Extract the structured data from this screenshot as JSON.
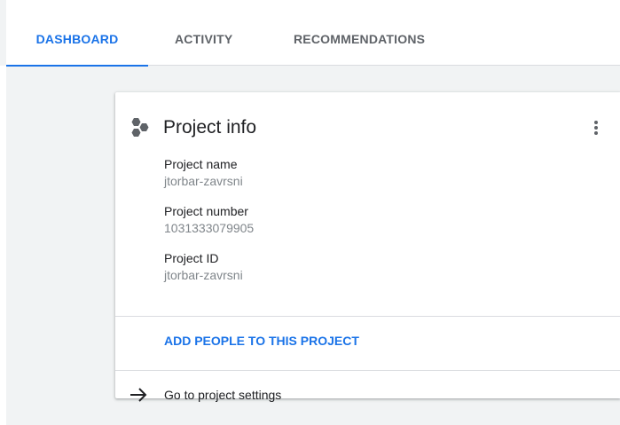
{
  "tabs": {
    "dashboard": "DASHBOARD",
    "activity": "ACTIVITY",
    "recommendations": "RECOMMENDATIONS",
    "active": "dashboard"
  },
  "card": {
    "title": "Project info",
    "icon": "hexagon-group-icon",
    "menu_icon": "more-vert-icon",
    "fields": [
      {
        "label": "Project name",
        "value": "jtorbar-zavrsni"
      },
      {
        "label": "Project number",
        "value": "1031333079905"
      },
      {
        "label": "Project ID",
        "value": "jtorbar-zavrsni"
      }
    ],
    "add_people_label": "ADD PEOPLE TO THIS PROJECT",
    "settings_link_label": "Go to project settings",
    "settings_icon": "arrow-forward-icon"
  },
  "colors": {
    "accent": "#1a73e8",
    "text_primary": "#202124",
    "text_secondary": "#80868b",
    "background": "#f1f3f4"
  }
}
